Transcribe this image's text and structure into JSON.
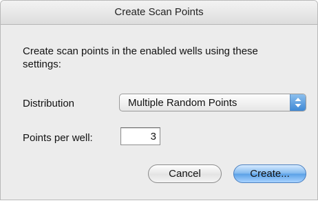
{
  "dialog": {
    "title": "Create Scan Points",
    "description": "Create scan points in the enabled wells using these settings:"
  },
  "distribution": {
    "label": "Distribution",
    "selected": "Multiple Random Points"
  },
  "points_per_well": {
    "label": "Points per well:",
    "value": "3"
  },
  "buttons": {
    "cancel": "Cancel",
    "create": "Create..."
  },
  "colors": {
    "accent": "#5aa0e6",
    "window_bg": "#ececec"
  },
  "icons": {
    "popup_arrows": "up-down-arrows-icon"
  }
}
